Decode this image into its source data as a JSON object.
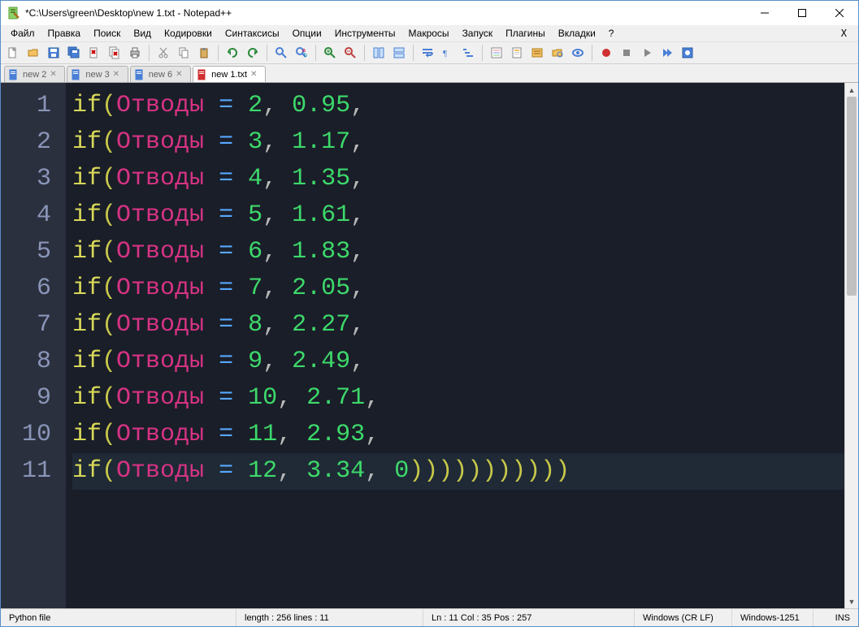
{
  "window": {
    "title": "*C:\\Users\\green\\Desktop\\new 1.txt - Notepad++"
  },
  "menu": {
    "items": [
      "Файл",
      "Правка",
      "Поиск",
      "Вид",
      "Кодировки",
      "Синтаксисы",
      "Опции",
      "Инструменты",
      "Макросы",
      "Запуск",
      "Плагины",
      "Вкладки",
      "?"
    ]
  },
  "tabs": [
    {
      "label": "new 2",
      "active": false,
      "modified": false
    },
    {
      "label": "new 3",
      "active": false,
      "modified": false
    },
    {
      "label": "new 6",
      "active": false,
      "modified": false
    },
    {
      "label": "new 1.txt",
      "active": true,
      "modified": true
    }
  ],
  "code": {
    "lines": [
      {
        "args": [
          "Отводы",
          "2",
          "0.95"
        ],
        "tail": ","
      },
      {
        "args": [
          "Отводы",
          "3",
          "1.17"
        ],
        "tail": ","
      },
      {
        "args": [
          "Отводы",
          "4",
          "1.35"
        ],
        "tail": ","
      },
      {
        "args": [
          "Отводы",
          "5",
          "1.61"
        ],
        "tail": ","
      },
      {
        "args": [
          "Отводы",
          "6",
          "1.83"
        ],
        "tail": ","
      },
      {
        "args": [
          "Отводы",
          "7",
          "2.05"
        ],
        "tail": ","
      },
      {
        "args": [
          "Отводы",
          "8",
          "2.27"
        ],
        "tail": ","
      },
      {
        "args": [
          "Отводы",
          "9",
          "2.49"
        ],
        "tail": ","
      },
      {
        "args": [
          "Отводы",
          "10",
          "2.71"
        ],
        "tail": ","
      },
      {
        "args": [
          "Отводы",
          "11",
          "2.93"
        ],
        "tail": ","
      },
      {
        "args": [
          "Отводы",
          "12",
          "3.34",
          "0"
        ],
        "tail": ")))))))))))"
      }
    ],
    "current_line": 11
  },
  "status": {
    "filetype": "Python file",
    "length_label": "length : 256    lines : 11",
    "position": "Ln : 11    Col : 35    Pos : 257",
    "eol": "Windows (CR LF)",
    "encoding": "Windows-1251",
    "insert_mode": "INS"
  },
  "toolbar_icons": [
    "new-file",
    "open-file",
    "save-file",
    "save-all",
    "close-file",
    "close-all",
    "print",
    "sep",
    "cut",
    "copy",
    "paste",
    "sep",
    "undo",
    "redo",
    "sep",
    "find",
    "replace",
    "sep",
    "zoom-in",
    "zoom-out",
    "sep",
    "sync-v",
    "sync-h",
    "sep",
    "wrap",
    "all-chars",
    "indent-guide",
    "sep",
    "lang",
    "doc-map",
    "doc-list",
    "folder",
    "show-all",
    "sep",
    "record",
    "stop",
    "play",
    "play-multi",
    "save-macro"
  ],
  "colors": {
    "bg": "#1a1e29",
    "gutter": "#2b303e",
    "gutter_fg": "#8a95b8",
    "kw": "#d8d858",
    "ident": "#d63384",
    "op": "#57a8ff",
    "num": "#3dd96a"
  }
}
